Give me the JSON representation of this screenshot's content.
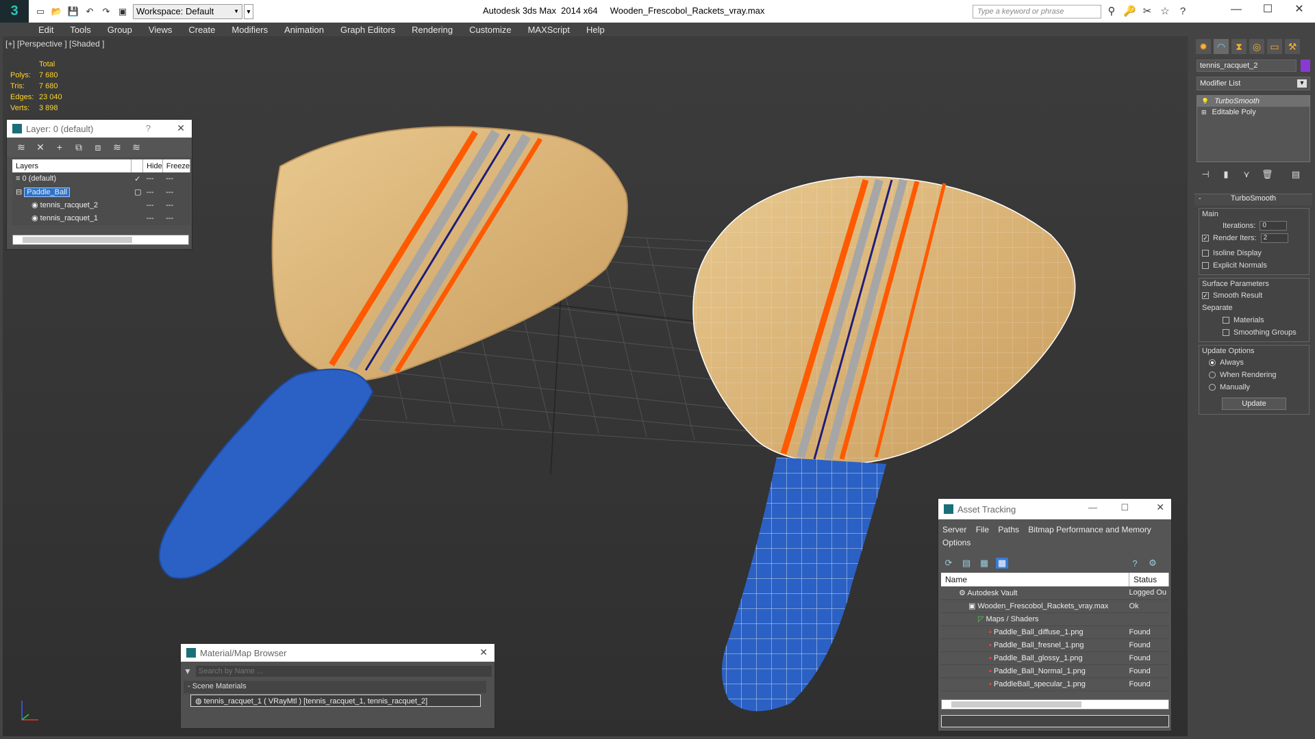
{
  "app": {
    "title": "Autodesk 3ds Max  2014 x64     Wooden_Frescobol_Rackets_vray.max",
    "workspace": "Workspace: Default",
    "search_placeholder": "Type a keyword or phrase"
  },
  "menu": [
    "Edit",
    "Tools",
    "Group",
    "Views",
    "Create",
    "Modifiers",
    "Animation",
    "Graph Editors",
    "Rendering",
    "Customize",
    "MAXScript",
    "Help"
  ],
  "viewport": {
    "label": "[+] [Perspective ] [Shaded ]",
    "stats": {
      "header": "Total",
      "rows": [
        {
          "k": "Polys:",
          "v": "7 680"
        },
        {
          "k": "Tris:",
          "v": "7 680"
        },
        {
          "k": "Edges:",
          "v": "23 040"
        },
        {
          "k": "Verts:",
          "v": "3 898"
        }
      ]
    }
  },
  "layer_panel": {
    "title": "Layer: 0 (default)",
    "help": "?",
    "cols": {
      "layers": "Layers",
      "hide": "Hide",
      "freeze": "Freeze"
    },
    "rows": [
      {
        "name": "0 (default)",
        "check": "✓"
      },
      {
        "name": "Paddle_Ball",
        "check": ""
      },
      {
        "name": "tennis_racquet_2",
        "check": ""
      },
      {
        "name": "tennis_racquet_1",
        "check": ""
      }
    ]
  },
  "material_browser": {
    "title": "Material/Map Browser",
    "search_placeholder": "Search by Name ...",
    "section": "Scene Materials",
    "item": "tennis_racquet_1  ( VRayMtl )  [tennis_racquet_1, tennis_racquet_2]"
  },
  "asset_tracking": {
    "title": "Asset Tracking",
    "menu1": [
      "Server",
      "File",
      "Paths",
      "Bitmap Performance and Memory"
    ],
    "menu2": [
      "Options"
    ],
    "cols": {
      "name": "Name",
      "status": "Status"
    },
    "rows": [
      {
        "name": "Autodesk Vault",
        "status": "Logged Ou"
      },
      {
        "name": "Wooden_Frescobol_Rackets_vray.max",
        "status": "Ok"
      },
      {
        "name": "Maps / Shaders",
        "status": ""
      },
      {
        "name": "Paddle_Ball_diffuse_1.png",
        "status": "Found"
      },
      {
        "name": "Paddle_Ball_fresnel_1.png",
        "status": "Found"
      },
      {
        "name": "Paddle_Ball_glossy_1.png",
        "status": "Found"
      },
      {
        "name": "Paddle_Ball_Normal_1.png",
        "status": "Found"
      },
      {
        "name": "PaddleBall_specular_1.png",
        "status": "Found"
      }
    ]
  },
  "command_panel": {
    "object_name": "tennis_racquet_2",
    "object_color": "#8a39d1",
    "modifier_list": "Modifier List",
    "stack": [
      "TurboSmooth",
      "Editable Poly"
    ],
    "rollout": "TurboSmooth",
    "main_label": "Main",
    "iterations_label": "Iterations:",
    "iterations": "0",
    "render_iters_label": "Render Iters:",
    "render_iters": "2",
    "isoline": "Isoline Display",
    "explicit_normals": "Explicit Normals",
    "surface_params": "Surface Parameters",
    "smooth_result": "Smooth Result",
    "separate": "Separate",
    "materials": "Materials",
    "smoothing_groups": "Smoothing Groups",
    "update_options": "Update Options",
    "always": "Always",
    "when_rendering": "When Rendering",
    "manually": "Manually",
    "update_button": "Update"
  }
}
